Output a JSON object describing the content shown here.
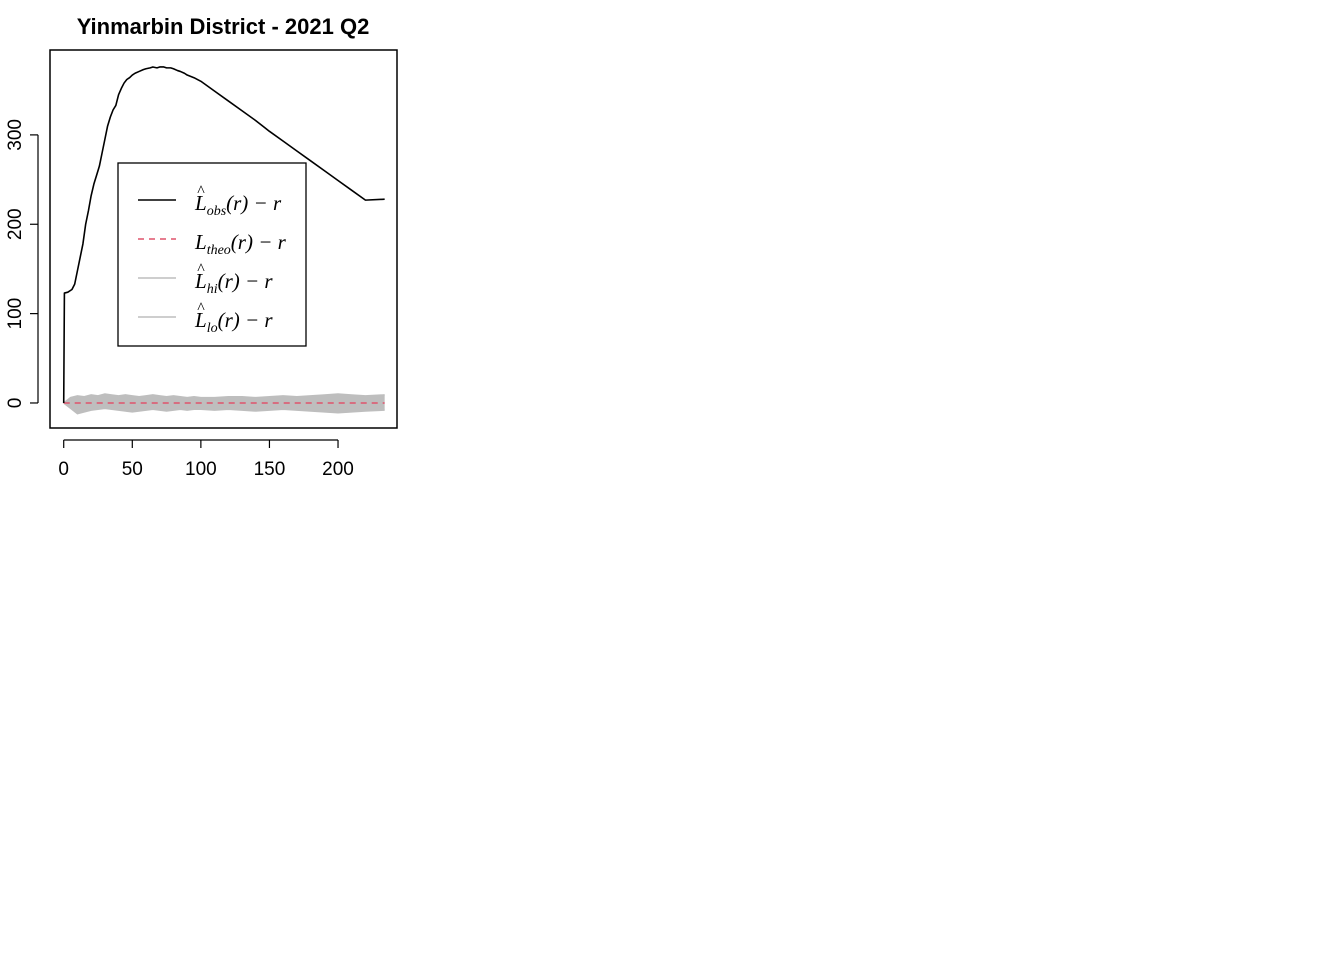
{
  "chart_data": {
    "type": "line",
    "title": "Yinmarbin District - 2021 Q2",
    "xlabel": "",
    "ylabel": "",
    "xlim": [
      -10,
      243
    ],
    "ylim": [
      -28,
      395
    ],
    "x_ticks": [
      0,
      50,
      100,
      150,
      200
    ],
    "y_ticks": [
      0,
      100,
      200,
      300
    ],
    "grid": false,
    "legend_position": "center-left",
    "colors": {
      "obs": "#000000",
      "theo": "#DF536B",
      "envelope": "#BEBEBE"
    },
    "series": [
      {
        "name": "L̂obs(r) − r",
        "legend": {
          "main": "L",
          "hat": true,
          "sub": "obs",
          "rest": "(r) − r"
        },
        "style": "solid",
        "x": [
          0,
          0.5,
          3,
          6,
          8,
          10,
          12,
          14,
          16,
          18,
          20,
          22,
          24,
          26,
          28,
          30,
          32,
          34,
          36,
          38,
          40,
          42,
          44,
          46,
          48,
          50,
          52,
          55,
          58,
          60,
          63,
          65,
          68,
          70,
          73,
          75,
          78,
          80,
          83,
          85,
          88,
          90,
          95,
          100,
          110,
          120,
          130,
          140,
          150,
          160,
          170,
          180,
          190,
          200,
          210,
          220,
          234
        ],
        "y": [
          0,
          123,
          124,
          127,
          133,
          148,
          163,
          178,
          200,
          215,
          232,
          245,
          255,
          265,
          280,
          295,
          310,
          320,
          328,
          333,
          345,
          352,
          358,
          362,
          364,
          367,
          369,
          371,
          373,
          374,
          375,
          376,
          375,
          376,
          376,
          375,
          375,
          374,
          372,
          371,
          369,
          367,
          364,
          360,
          349,
          338,
          327,
          316,
          304,
          293,
          282,
          271,
          260,
          249,
          238,
          227,
          228
        ]
      },
      {
        "name": "Ltheo(r) − r",
        "legend": {
          "main": "L",
          "hat": false,
          "sub": "theo",
          "rest": "(r) − r"
        },
        "style": "dashed",
        "x": [
          0,
          234
        ],
        "y": [
          0,
          0
        ]
      },
      {
        "name": "L̂hi(r) − r",
        "legend": {
          "main": "L",
          "hat": true,
          "sub": "hi",
          "rest": "(r) − r"
        },
        "style": "solid",
        "x": [
          0,
          5,
          10,
          15,
          20,
          25,
          30,
          35,
          40,
          45,
          50,
          55,
          60,
          65,
          70,
          75,
          80,
          85,
          90,
          95,
          100,
          110,
          120,
          130,
          140,
          150,
          160,
          170,
          180,
          190,
          200,
          210,
          220,
          234
        ],
        "y": [
          0,
          6,
          8,
          7,
          9,
          8,
          10,
          9,
          8,
          9,
          8,
          7,
          8,
          9,
          8,
          7,
          8,
          7,
          6,
          7,
          6,
          6,
          7,
          7,
          6,
          7,
          8,
          7,
          8,
          9,
          10,
          9,
          8,
          9
        ]
      },
      {
        "name": "L̂lo(r) − r",
        "legend": {
          "main": "L",
          "hat": true,
          "sub": "lo",
          "rest": "(r) − r"
        },
        "style": "solid",
        "x": [
          0,
          5,
          10,
          15,
          20,
          25,
          30,
          35,
          40,
          45,
          50,
          55,
          60,
          65,
          70,
          75,
          80,
          85,
          90,
          95,
          100,
          110,
          120,
          130,
          140,
          150,
          160,
          170,
          180,
          190,
          200,
          210,
          220,
          234
        ],
        "y": [
          0,
          -6,
          -12,
          -10,
          -8,
          -7,
          -6,
          -7,
          -8,
          -9,
          -10,
          -9,
          -8,
          -7,
          -8,
          -9,
          -8,
          -7,
          -8,
          -7,
          -7,
          -8,
          -7,
          -8,
          -9,
          -8,
          -7,
          -8,
          -9,
          -10,
          -11,
          -10,
          -9,
          -8
        ]
      }
    ]
  }
}
